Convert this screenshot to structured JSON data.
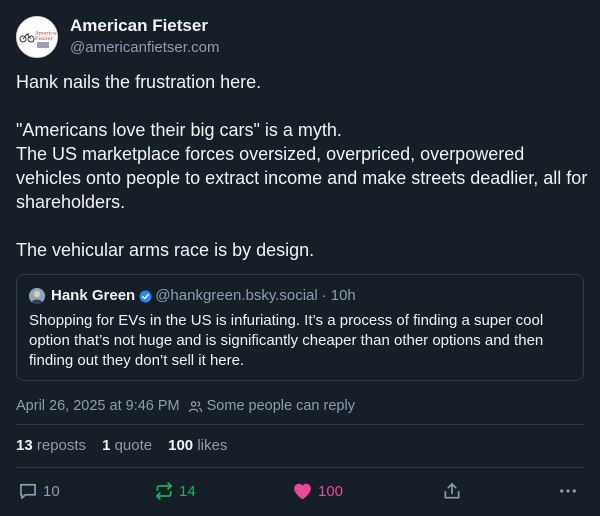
{
  "author": {
    "display_name": "American Fietser",
    "handle": "@americanfietser.com",
    "avatar_text": "American Fietser"
  },
  "post": {
    "paragraphs": [
      "Hank nails the frustration here.",
      "\"Americans love their big cars\" is a myth.",
      "The US marketplace forces oversized, overpriced, overpowered vehicles onto people to extract income and make streets deadlier, all for shareholders.",
      "The vehicular arms race is by design."
    ]
  },
  "quote": {
    "name": "Hank Green",
    "handle": "@hankgreen.bsky.social",
    "separator": "·",
    "time": "10h",
    "text": "Shopping for EVs in the US is infuriating. It’s a process of finding a super cool option that’s not huge and is significantly cheaper than other options and then finding out they don’t sell it here."
  },
  "meta": {
    "timestamp": "April 26, 2025 at 9:46 PM",
    "reply_setting": "Some people can reply"
  },
  "stats": {
    "reposts_count": "13",
    "reposts_label": "reposts",
    "quotes_count": "1",
    "quotes_label": "quote",
    "likes_count": "100",
    "likes_label": "likes"
  },
  "actions": {
    "reply_count": "10",
    "repost_count": "14",
    "like_count": "100"
  },
  "colors": {
    "background": "#161e27",
    "muted_text": "#8d9db0",
    "repost_green": "#19b35c",
    "like_pink": "#ec4899",
    "verified_blue": "#208bfe"
  },
  "icons": [
    "verified-badge-icon",
    "people-icon",
    "reply-icon",
    "repost-icon",
    "heart-icon",
    "share-icon",
    "more-icon"
  ]
}
